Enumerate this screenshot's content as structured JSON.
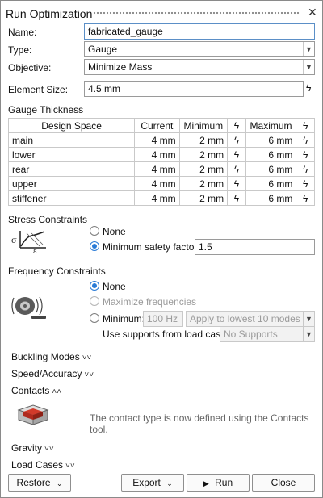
{
  "window": {
    "title": "Run Optimization"
  },
  "name_field": {
    "label": "Name:",
    "value": "fabricated_gauge"
  },
  "type_field": {
    "label": "Type:",
    "value": "Gauge"
  },
  "objective_field": {
    "label": "Objective:",
    "value": "Minimize Mass"
  },
  "element_size": {
    "label": "Element Size:",
    "value": "4.5 mm"
  },
  "gauge": {
    "title": "Gauge Thickness",
    "columns": [
      "Design Space",
      "Current",
      "Minimum",
      "Maximum"
    ],
    "rows": [
      {
        "name": "main",
        "current": "4 mm",
        "minimum": "2 mm",
        "maximum": "6 mm"
      },
      {
        "name": "lower",
        "current": "4 mm",
        "minimum": "2 mm",
        "maximum": "6 mm"
      },
      {
        "name": "rear",
        "current": "4 mm",
        "minimum": "2 mm",
        "maximum": "6 mm"
      },
      {
        "name": "upper",
        "current": "4 mm",
        "minimum": "2 mm",
        "maximum": "6 mm"
      },
      {
        "name": "stiffener",
        "current": "4 mm",
        "minimum": "2 mm",
        "maximum": "6 mm"
      }
    ]
  },
  "stress": {
    "title": "Stress Constraints",
    "opt_none": "None",
    "opt_min": "Minimum safety factor:",
    "min_value": "1.5",
    "selected": "min"
  },
  "frequency": {
    "title": "Frequency Constraints",
    "opt_none": "None",
    "opt_max": "Maximize frequencies",
    "opt_min": "Minimum:",
    "min_value": "100 Hz",
    "apply_value": "Apply to lowest 10 modes",
    "supports_label": "Use supports from load case:",
    "supports_value": "No Supports",
    "selected": "none"
  },
  "sections": {
    "buckling": "Buckling Modes",
    "speed": "Speed/Accuracy",
    "contacts": "Contacts",
    "gravity": "Gravity",
    "loadcases": "Load Cases"
  },
  "contacts_note": "The contact type is now defined using the Contacts tool.",
  "buttons": {
    "restore": "Restore",
    "export": "Export",
    "run": "Run",
    "close": "Close"
  },
  "colors": {
    "accent": "#2a7bd6",
    "contact_icon_red": "#d23a2a"
  }
}
